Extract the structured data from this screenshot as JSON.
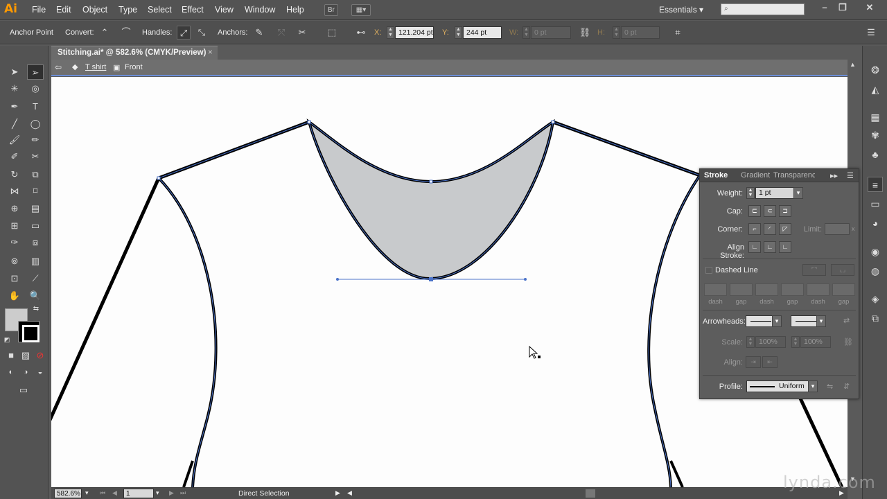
{
  "app": {
    "logo": "Ai"
  },
  "menu": [
    "File",
    "Edit",
    "Object",
    "Type",
    "Select",
    "Effect",
    "View",
    "Window",
    "Help"
  ],
  "menubar": {
    "bridge_label": "Br",
    "workspace": "Essentials ▾"
  },
  "control": {
    "tool_name": "Anchor Point",
    "convert_label": "Convert:",
    "handles_label": "Handles:",
    "anchors_label": "Anchors:",
    "x_label": "X:",
    "x_value": "121.204 pt",
    "y_label": "Y:",
    "y_value": "244 pt",
    "w_label": "W:",
    "w_value": "0 pt",
    "h_label": "H:",
    "h_value": "0 pt"
  },
  "document": {
    "tab_title": "Stitching.ai* @ 582.6% (CMYK/Preview)",
    "close": "×"
  },
  "breadcrumb": {
    "layer": "T shirt",
    "group": "Front"
  },
  "stroke_panel": {
    "tabs": [
      "Stroke",
      "Gradient",
      "Transparency"
    ],
    "weight_label": "Weight:",
    "weight_value": "1 pt",
    "cap_label": "Cap:",
    "corner_label": "Corner:",
    "limit_label": "Limit:",
    "align_label": "Align Stroke:",
    "dashed_label": "Dashed Line",
    "dash_labels": [
      "dash",
      "gap",
      "dash",
      "gap",
      "dash",
      "gap"
    ],
    "arrowheads_label": "Arrowheads:",
    "scale_label": "Scale:",
    "scale_start": "100%",
    "scale_end": "100%",
    "align2_label": "Align:",
    "profile_label": "Profile:",
    "profile_value": "Uniform"
  },
  "status": {
    "zoom": "582.6%",
    "artboard": "1",
    "tool": "Direct Selection"
  },
  "watermark": "lynda.com",
  "colors": {
    "accent_orange": "#ff9a00",
    "path_blue": "#4a72c9",
    "neck_fill": "#c8cacc"
  }
}
